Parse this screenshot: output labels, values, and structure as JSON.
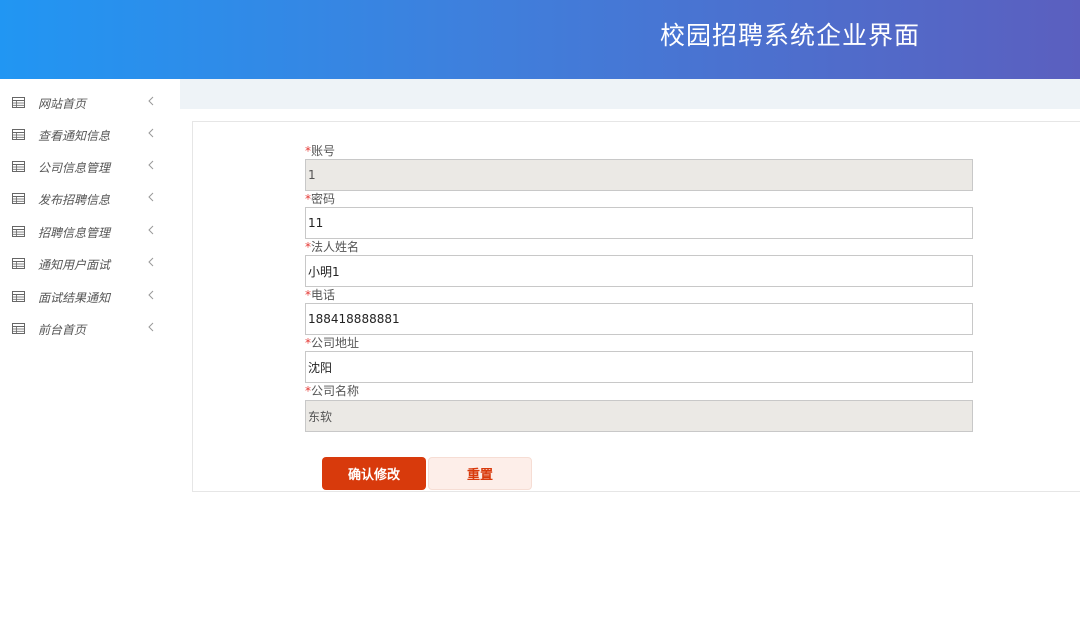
{
  "header": {
    "title": "校园招聘系统企业界面"
  },
  "sidebar": {
    "items": [
      {
        "label": "网站首页",
        "icon": "table-icon"
      },
      {
        "label": "查看通知信息",
        "icon": "table-icon"
      },
      {
        "label": "公司信息管理",
        "icon": "table-icon"
      },
      {
        "label": "发布招聘信息",
        "icon": "table-icon"
      },
      {
        "label": "招聘信息管理",
        "icon": "table-icon"
      },
      {
        "label": "通知用户面试",
        "icon": "table-icon"
      },
      {
        "label": "面试结果通知",
        "icon": "table-icon"
      },
      {
        "label": "前台首页",
        "icon": "table-icon"
      }
    ]
  },
  "form": {
    "required_mark": "*",
    "fields": [
      {
        "label": "账号",
        "value": "1",
        "readonly": true
      },
      {
        "label": "密码",
        "value": "11",
        "readonly": false
      },
      {
        "label": "法人姓名",
        "value": "小明1",
        "readonly": false
      },
      {
        "label": "电话",
        "value": "188418888881",
        "readonly": false
      },
      {
        "label": "公司地址",
        "value": "沈阳",
        "readonly": false
      },
      {
        "label": "公司名称",
        "value": "东软",
        "readonly": true
      }
    ],
    "confirm_label": "确认修改",
    "reset_label": "重置"
  },
  "colors": {
    "header_start": "#2196f3",
    "header_end": "#5b5fbf",
    "accent": "#d83a0c",
    "required": "#e53935",
    "readonly_bg": "#ebe9e5"
  }
}
